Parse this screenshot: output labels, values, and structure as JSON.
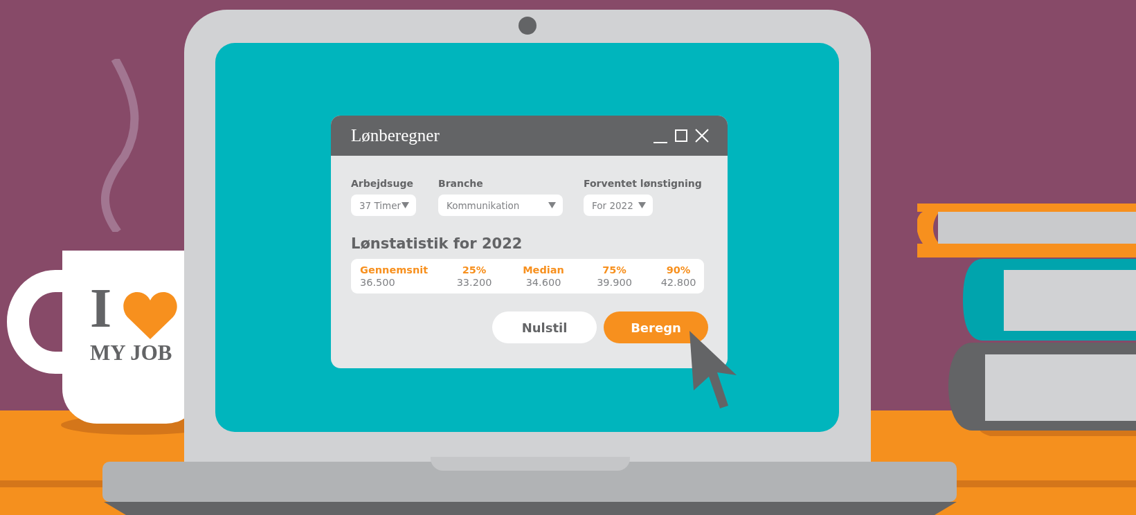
{
  "window": {
    "title": "Lønberegner"
  },
  "fields": [
    {
      "label": "Arbejdsuge",
      "value": "37 Timer"
    },
    {
      "label": "Branche",
      "value": "Kommunikation"
    },
    {
      "label": "Forventet lønstigning",
      "value": "For 2022"
    }
  ],
  "statistics": {
    "heading": "Lønstatistik for 2022",
    "columns": [
      {
        "label": "Gennemsnit",
        "value": "36.500"
      },
      {
        "label": "25%",
        "value": "33.200"
      },
      {
        "label": "Median",
        "value": "34.600"
      },
      {
        "label": "75%",
        "value": "39.900"
      },
      {
        "label": "90%",
        "value": "42.800"
      }
    ]
  },
  "buttons": [
    {
      "label": "Nulstil",
      "kind": "secondary"
    },
    {
      "label": "Beregn",
      "kind": "primary"
    }
  ],
  "mug": {
    "line_1": "I",
    "line_2": "MY JOB"
  }
}
